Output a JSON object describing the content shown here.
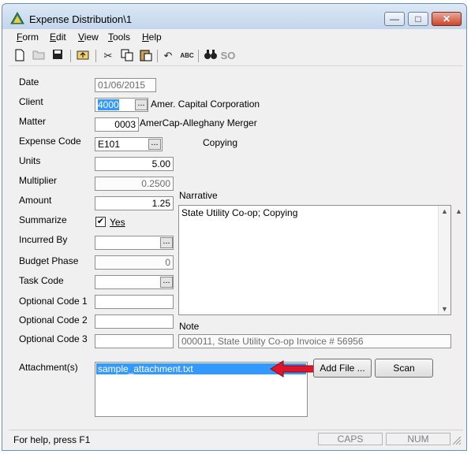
{
  "window": {
    "title": "Expense Distribution\\1",
    "minimize": "—",
    "maximize": "□",
    "close": "✕"
  },
  "menu": [
    "Form",
    "Edit",
    "View",
    "Tools",
    "Help"
  ],
  "menu_underline": [
    "F",
    "E",
    "V",
    "T",
    "H"
  ],
  "toolbar": {
    "new": "🗋",
    "open": "📂",
    "save": "💾",
    "up": "⬑",
    "cut": "✂",
    "copy": "⎘",
    "paste": "📋",
    "undo": "↶",
    "spell": "ABC",
    "find": "🔍",
    "so": "SO"
  },
  "form": {
    "date_label": "Date",
    "date_value": "01/06/2015",
    "client_label": "Client",
    "client_value": "4000",
    "client_name": "Amer. Capital Corporation",
    "matter_label": "Matter",
    "matter_value": "0003",
    "matter_name": "AmerCap-Alleghany Merger",
    "expense_code_label": "Expense Code",
    "expense_code_value": "E101",
    "expense_code_desc": "Copying",
    "units_label": "Units",
    "units_value": "5.00",
    "multiplier_label": "Multiplier",
    "multiplier_value": "0.2500",
    "amount_label": "Amount",
    "amount_value": "1.25",
    "summarize_label": "Summarize",
    "summarize_check": "✔",
    "summarize_yes": "Yes",
    "incurred_by_label": "Incurred By",
    "incurred_by_value": "",
    "budget_phase_label": "Budget Phase",
    "budget_phase_value": "0",
    "task_code_label": "Task Code",
    "task_code_value": "",
    "optional_code_1_label": "Optional Code 1",
    "optional_code_1_value": "",
    "optional_code_2_label": "Optional Code 2",
    "optional_code_2_value": "",
    "optional_code_3_label": "Optional Code 3",
    "optional_code_3_value": "",
    "narrative_label": "Narrative",
    "narrative_value": "State Utility Co-op; Copying",
    "note_label": "Note",
    "note_value": "000011, State Utility Co-op Invoice # 56956",
    "attachments_label": "Attachment(s)",
    "attachment_item": "sample_attachment.txt",
    "add_file_button": "Add File ...",
    "scan_button": "Scan",
    "ellipsis": "..."
  },
  "status": {
    "help_text": "For help, press F1",
    "caps": "CAPS",
    "num": "NUM"
  },
  "colors": {
    "selection": "#3399ff",
    "arrow": "#e0142a"
  }
}
